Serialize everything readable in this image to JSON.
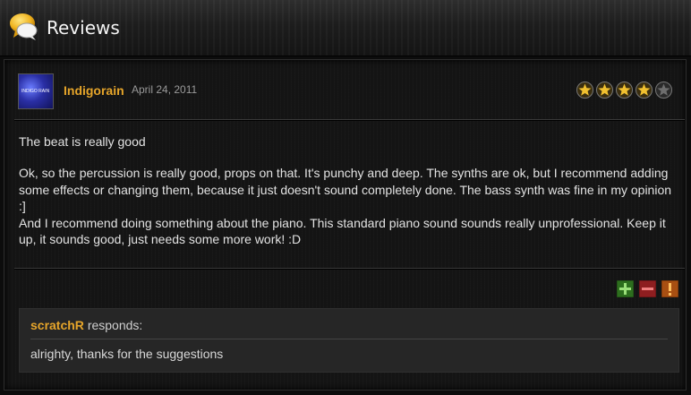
{
  "header": {
    "title": "Reviews"
  },
  "review": {
    "username": "Indigorain",
    "avatar_text": "INDIGO RAIN",
    "date": "April 24, 2011",
    "rating": 4,
    "rating_max": 5,
    "title": "The beat is really good",
    "body": [
      "Ok, so the percussion is really good, props on that. It's punchy and deep. The synths are ok, but I recommend adding some effects or changing them, because it just doesn't sound completely done. The bass synth was fine in my opinion :]",
      "And I recommend doing something about the piano. This standard piano sound sounds really unprofessional. Keep it up, it sounds good, just needs some more work! :D"
    ]
  },
  "actions": {
    "helpful_icon": "plus-icon",
    "unhelpful_icon": "minus-icon",
    "report_icon": "exclamation-icon"
  },
  "response": {
    "username": "scratchR",
    "label": "responds:",
    "text": "alrighty, thanks for the suggestions"
  },
  "colors": {
    "username": "#e6a52a",
    "star_filled": "#f0c030",
    "star_empty": "#6e6e6e",
    "helpful": "#3f8f2a",
    "unhelpful": "#b0282a",
    "report": "#c2601a"
  }
}
